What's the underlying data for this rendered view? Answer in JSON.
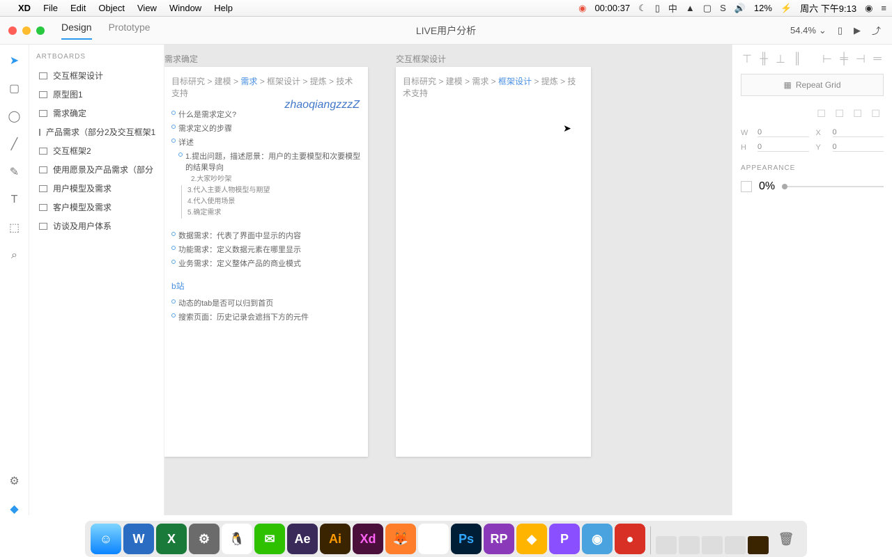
{
  "menubar": {
    "app": "XD",
    "items": [
      "File",
      "Edit",
      "Object",
      "View",
      "Window",
      "Help"
    ],
    "rec_time": "00:00:37",
    "battery": "12%",
    "date": "周六 下午9:13"
  },
  "toolbar": {
    "tabs": {
      "design": "Design",
      "prototype": "Prototype"
    },
    "title": "LIVE用户分析",
    "zoom": "54.4%"
  },
  "artboards_header": "ARTBOARDS",
  "artboards": [
    "交互框架设计",
    "原型图1",
    "需求确定",
    "产品需求（部分2及交互框架1",
    "交互框架2",
    "使用愿景及产品需求（部分",
    "用户模型及需求",
    "客户模型及需求",
    "访谈及用户体系"
  ],
  "canvas": {
    "ab1": {
      "label": "需求确定",
      "breadcrumb": {
        "pre": "目标研究 > 建模 > ",
        "hl": "需求",
        "post": " > 框架设计 > 提炼 > 技术支持"
      },
      "watermark": "zhaoqiangzzzZ",
      "lines": [
        "什么是需求定义?",
        "需求定义的步骤",
        "详述"
      ],
      "sublines": [
        "1.提出问题，描述愿景：用户的主要模型和次要模型的结果导向",
        "2.大家吵吵架",
        "3.代入主要人物模型与期望",
        "4.代入使用场景",
        "5.确定需求"
      ],
      "lines2": [
        "数据需求：代表了界面中显示的内容",
        "功能需求：定义数据元素在哪里显示",
        "业务需求：定义整体产品的商业模式"
      ],
      "link": "b站",
      "lines3": [
        "动态的tab是否可以归到首页",
        "搜索页面：历史记录会遮挡下方的元件"
      ]
    },
    "ab2": {
      "label": "交互框架设计",
      "breadcrumb": {
        "pre": "目标研究  > 建模  > 需求 > ",
        "hl": "框架设计",
        "post": " > 提炼 > 技术支持"
      }
    }
  },
  "right": {
    "repeat": "Repeat Grid",
    "dims": {
      "w": "W",
      "wval": "0",
      "x": "X",
      "xval": "0",
      "h": "H",
      "hval": "0",
      "y": "Y",
      "yval": "0"
    },
    "appearance": "APPEARANCE",
    "opacity": "0%"
  }
}
